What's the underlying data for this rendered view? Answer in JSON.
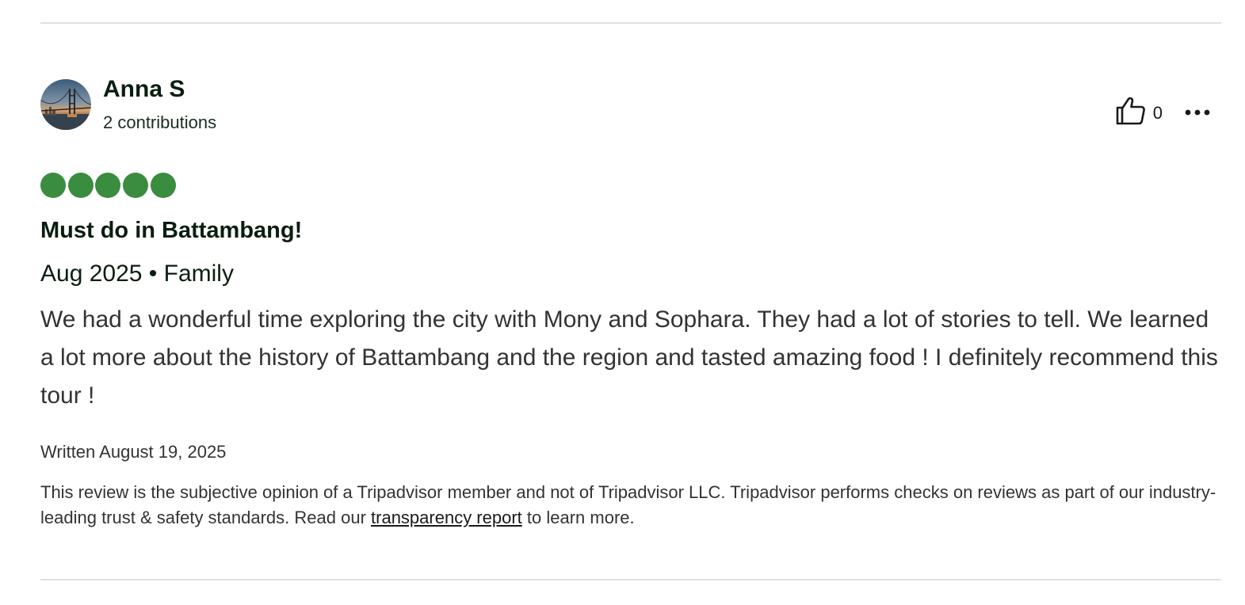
{
  "review": {
    "user": {
      "name": "Anna S",
      "contributions": "2 contributions"
    },
    "helpful": {
      "count": "0"
    },
    "rating": {
      "value": 5,
      "max": 5,
      "color": "#3a8c3f"
    },
    "title": "Must do in Battambang!",
    "meta": "Aug 2025 • Family",
    "body": "We had a wonderful time exploring the city with Mony and Sophara. They had a lot of stories to tell. We learned a lot more about the history of Battambang and the region and tasted amazing food ! I definitely recommend this tour !",
    "written": "Written August 19, 2025",
    "disclaimer": {
      "before": "This review is the subjective opinion of a Tripadvisor member and not of Tripadvisor LLC. Tripadvisor performs checks on reviews as part of our industry-leading trust & safety standards. Read our ",
      "link_text": "transparency report",
      "after": " to learn more."
    }
  },
  "icons": {
    "helpful": "thumbs-up-icon",
    "more": "more-options-icon"
  }
}
